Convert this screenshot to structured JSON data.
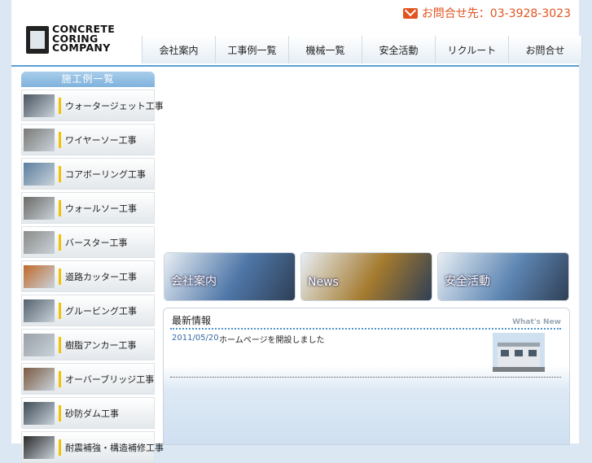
{
  "header": {
    "logo_lines": [
      "CONCRETE",
      "CORING",
      "COMPANY"
    ],
    "contact": "お問合せ先：03-3928-3023"
  },
  "gnav": [
    "会社案内",
    "工事例一覧",
    "機械一覧",
    "安全活動",
    "リクルート",
    "お問合せ"
  ],
  "sidebar": {
    "title": "施工例一覧",
    "items": [
      {
        "label": "ウォータージェット工事",
        "color": "#4a5560"
      },
      {
        "label": "ワイヤーソー工事",
        "color": "#7a7a76"
      },
      {
        "label": "コアボーリング工事",
        "color": "#5b7f9e"
      },
      {
        "label": "ウォールソー工事",
        "color": "#6b6a66"
      },
      {
        "label": "バースター工事",
        "color": "#8c8c88"
      },
      {
        "label": "道路カッター工事",
        "color": "#c06a2a"
      },
      {
        "label": "グルービング工事",
        "color": "#55626f"
      },
      {
        "label": "樹脂アンカー工事",
        "color": "#9aa0a6"
      },
      {
        "label": "オーバーブリッジ工事",
        "color": "#7a5a40"
      },
      {
        "label": "砂防ダム工事",
        "color": "#3e4a55"
      },
      {
        "label": "耐震補強・構造補修工事",
        "color": "#2a2a2a"
      }
    ]
  },
  "banners": [
    {
      "label": "会社案内",
      "color": "#4f77a8"
    },
    {
      "label": "News",
      "color": "#a47a2e"
    },
    {
      "label": "安全活動",
      "color": "#5d86b3"
    }
  ],
  "news": {
    "title": "最新情報",
    "badge": "What's New",
    "entries": [
      {
        "date": "2011/05/20",
        "text": "ホームページを開設しました"
      }
    ]
  }
}
